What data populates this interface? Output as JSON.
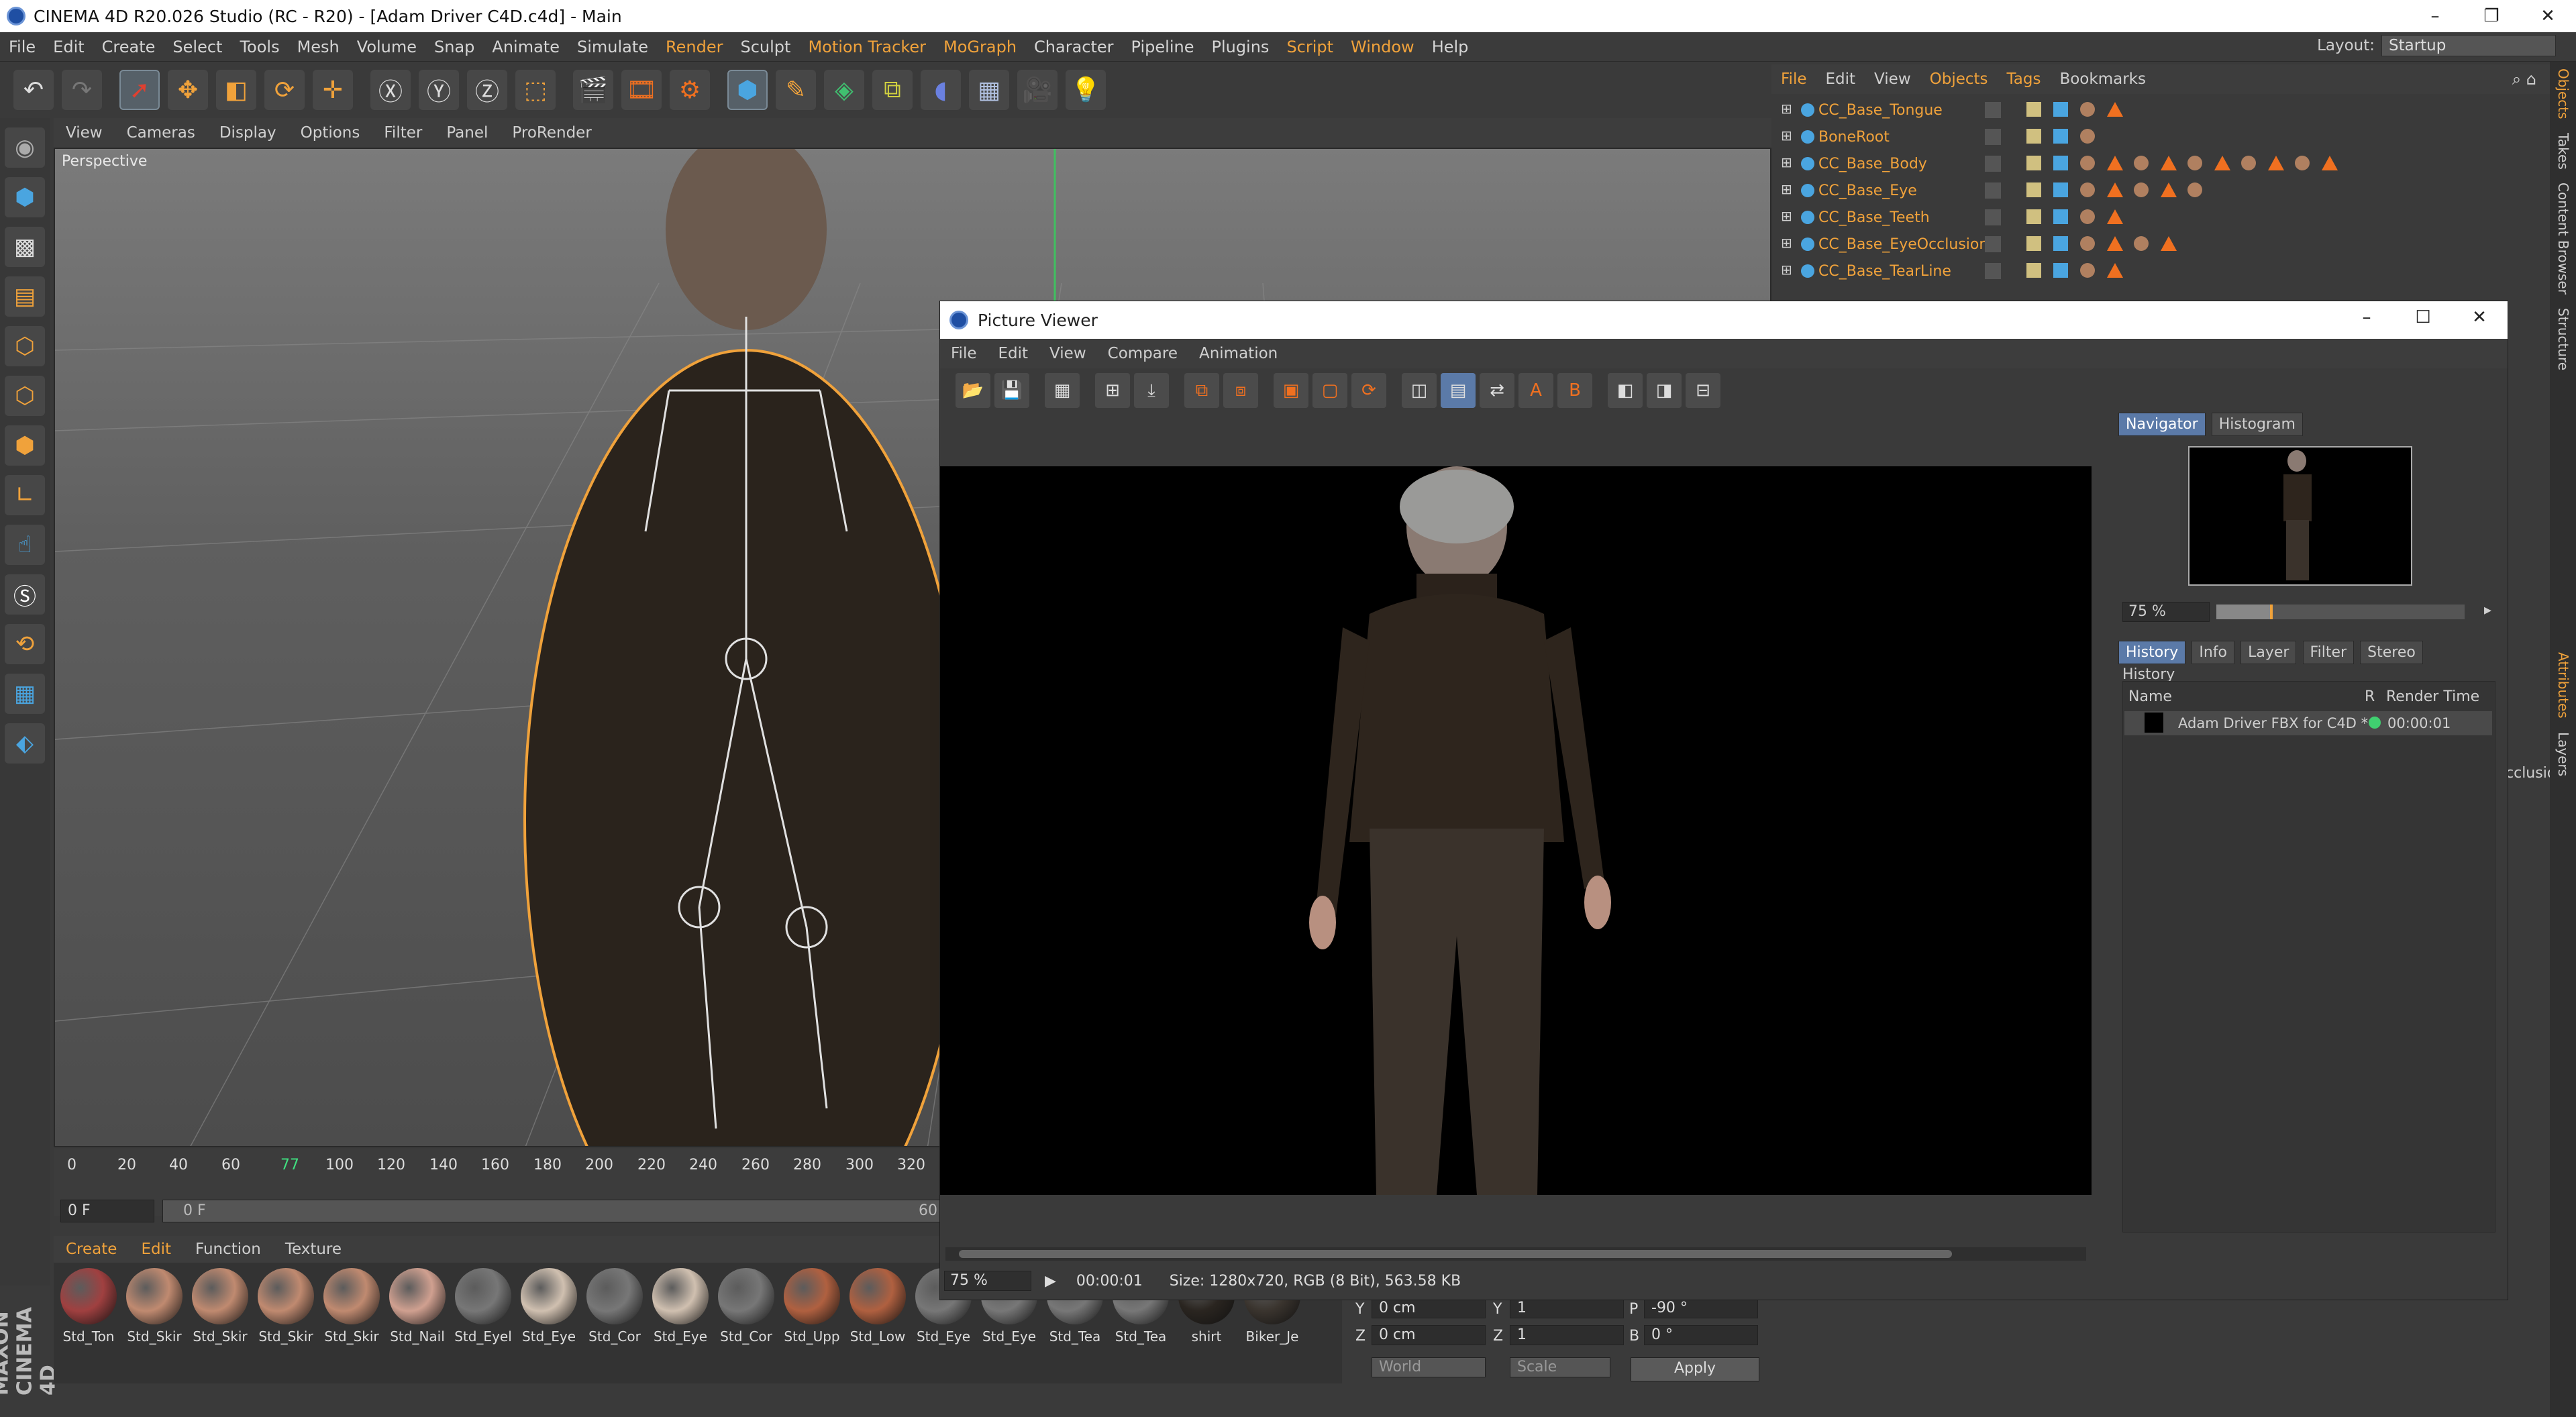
{
  "window": {
    "title": "CINEMA 4D R20.026 Studio (RC - R20) - [Adam Driver C4D.c4d] - Main",
    "controls": [
      "–",
      "❐",
      "✕"
    ]
  },
  "menubar": {
    "items": [
      "File",
      "Edit",
      "Create",
      "Select",
      "Tools",
      "Mesh",
      "Volume",
      "Snap",
      "Animate",
      "Simulate",
      "Render",
      "Sculpt",
      "Motion Tracker",
      "MoGraph",
      "Character",
      "Pipeline",
      "Plugins",
      "Script",
      "Window",
      "Help"
    ],
    "highlighted": [
      "Render",
      "Motion Tracker",
      "MoGraph",
      "Script",
      "Window"
    ],
    "layout_label": "Layout:",
    "layout_value": "Startup"
  },
  "viewport": {
    "menu": [
      "View",
      "Cameras",
      "Display",
      "Options",
      "Filter",
      "Panel",
      "ProRender"
    ],
    "camera_label": "Perspective"
  },
  "timeline": {
    "ticks": [
      "0",
      "20",
      "40",
      "60",
      "77",
      "100",
      "120",
      "140",
      "160",
      "180",
      "200",
      "220",
      "240",
      "260",
      "280",
      "300",
      "320"
    ],
    "current_frame": "0 F",
    "range_start": "0 F",
    "range_end": "60"
  },
  "material_manager": {
    "menu": [
      "Create",
      "Edit",
      "Function",
      "Texture"
    ],
    "materials": [
      {
        "name": "Std_Ton",
        "color": "#a04040"
      },
      {
        "name": "Std_Skir",
        "color": "#c08a70"
      },
      {
        "name": "Std_Skir",
        "color": "#c08a70"
      },
      {
        "name": "Std_Skir",
        "color": "#c08a70"
      },
      {
        "name": "Std_Skir",
        "color": "#c08a70"
      },
      {
        "name": "Std_Nail",
        "color": "#d0a090"
      },
      {
        "name": "Std_Eyel",
        "color": "#777"
      },
      {
        "name": "Std_Eye",
        "color": "#d0c0b0"
      },
      {
        "name": "Std_Cor",
        "color": "#777"
      },
      {
        "name": "Std_Eye",
        "color": "#d0c0b0"
      },
      {
        "name": "Std_Cor",
        "color": "#777"
      },
      {
        "name": "Std_Upp",
        "color": "#b06040"
      },
      {
        "name": "Std_Low",
        "color": "#b06040"
      },
      {
        "name": "Std_Eye",
        "color": "#777"
      },
      {
        "name": "Std_Eye",
        "color": "#777"
      },
      {
        "name": "Std_Tea",
        "color": "#777"
      },
      {
        "name": "Std_Tea",
        "color": "#777"
      },
      {
        "name": "shirt",
        "color": "#2a2520"
      },
      {
        "name": "Biker_Je",
        "color": "#3a342e"
      }
    ]
  },
  "coordinates": {
    "y_label": "Y",
    "y_pos": "0 cm",
    "y_size": "1",
    "p_label": "P",
    "p_val": "-90 °",
    "z_label": "Z",
    "z_pos": "0 cm",
    "z_size": "1",
    "b_label": "B",
    "b_val": "0 °",
    "mode1": "World",
    "mode2": "Scale",
    "apply": "Apply"
  },
  "object_manager": {
    "menu": [
      "File",
      "Edit",
      "View",
      "Objects",
      "Tags",
      "Bookmarks"
    ],
    "highlighted": [
      "File",
      "Objects",
      "Tags"
    ],
    "objects": [
      "CC_Base_Tongue",
      "BoneRoot",
      "CC_Base_Body",
      "CC_Base_Eye",
      "CC_Base_Teeth",
      "CC_Base_EyeOcclusion",
      "CC_Base_TearLine"
    ]
  },
  "right_tabs": [
    "Objects",
    "Takes",
    "Content Browser",
    "Structure",
    "Attributes",
    "Layers"
  ],
  "picture_viewer": {
    "title": "Picture Viewer",
    "menu": [
      "File",
      "Edit",
      "View",
      "Compare",
      "Animation"
    ],
    "nav_tabs": [
      "Navigator",
      "Histogram"
    ],
    "zoom": "75 %",
    "info_tabs": [
      "History",
      "Info",
      "Layer",
      "Filter",
      "Stereo"
    ],
    "history_title": "History",
    "history_cols": [
      "Name",
      "R",
      "Render Time"
    ],
    "history_rows": [
      {
        "name": "Adam Driver FBX for C4D *",
        "time": "00:00:01"
      }
    ],
    "status_zoom": "75 %",
    "status_time": "00:00:01",
    "status_size": "Size: 1280x720, RGB (8 Bit), 563.58 KB"
  },
  "attr_partial": "cclusio",
  "maxon": "MAXON CINEMA 4D",
  "colors": {
    "accent": "#f0a23b",
    "selection": "#5b7aa8"
  }
}
